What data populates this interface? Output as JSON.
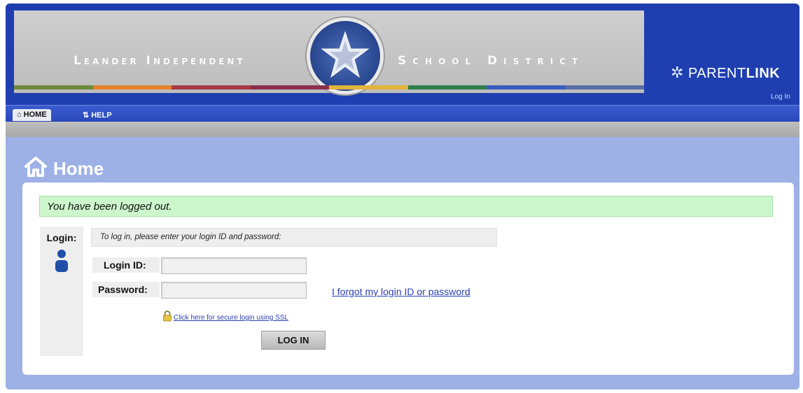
{
  "header": {
    "district_left": "Leander Independent",
    "district_right": "School District",
    "brand_prefix": "PARENT",
    "brand_suffix": "LINK",
    "top_login_link": "Log In",
    "stripe_colors": [
      "#6e8a3b",
      "#e4822b",
      "#a83a46",
      "#8b2f4a",
      "#e1b43b",
      "#2f7f4e",
      "#3a5dc0",
      "#5a6fa8"
    ]
  },
  "nav": {
    "tabs": [
      {
        "label": "HOME",
        "icon": "home-icon"
      },
      {
        "label": "HELP",
        "icon": "help-icon"
      }
    ]
  },
  "page": {
    "title": "Home"
  },
  "login": {
    "logout_message": "You have been logged out.",
    "label": "Login:",
    "instructions": "To log in, please enter your login ID and password:",
    "login_id_label": "Login ID:",
    "login_id_value": "",
    "password_label": "Password:",
    "password_value": "",
    "forgot_link": "I forgot my login ID or password",
    "ssl_link": "Click here for secure login using SSL",
    "submit_label": "LOG IN"
  },
  "colors": {
    "frame_blue": "#1f3fb0",
    "content_bg": "#9db1e6",
    "success_bg": "#ccf6cc",
    "link_blue": "#2a3fb0"
  }
}
